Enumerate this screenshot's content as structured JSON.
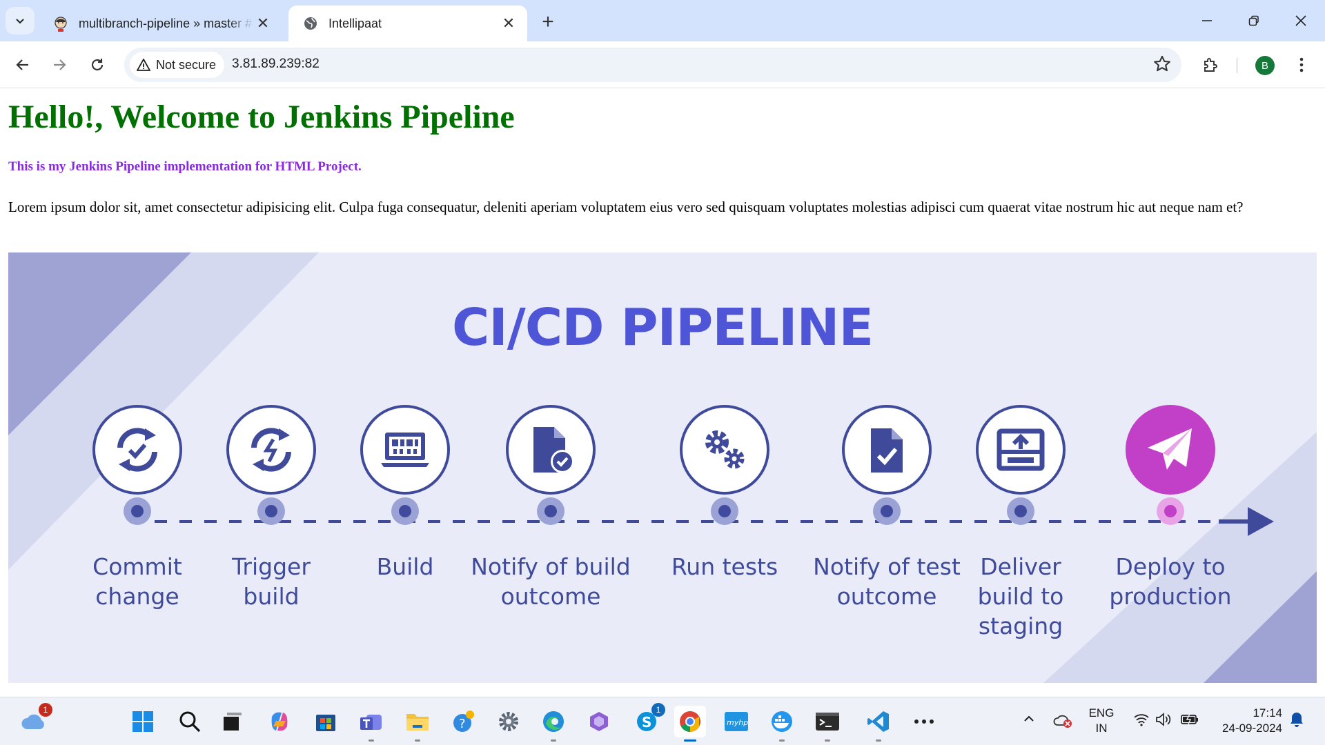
{
  "browser": {
    "tabs": [
      {
        "title": "multibranch-pipeline » master #",
        "favicon": "jenkins-icon",
        "active": false
      },
      {
        "title": "Intellipaat",
        "favicon": "globe-icon",
        "active": true
      }
    ],
    "security_label": "Not secure",
    "url": "3.81.89.239:82",
    "profile_initial": "B"
  },
  "page": {
    "heading": "Hello!, Welcome to Jenkins Pipeline",
    "subheading": "This is my Jenkins Pipeline implementation for HTML Project.",
    "paragraph": "Lorem ipsum dolor sit, amet consectetur adipisicing elit. Culpa fuga consequatur, deleniti aperiam voluptatem eius vero sed quisquam voluptates molestias adipisci cum quaerat vitae nostrum hic aut neque nam et?",
    "banner": {
      "title": "CI/CD PIPELINE",
      "steps": [
        {
          "label": "Commit\nchange",
          "icon": "commit-sync-icon"
        },
        {
          "label": "Trigger\nbuild",
          "icon": "trigger-sync-icon"
        },
        {
          "label": "Build",
          "icon": "build-computer-icon"
        },
        {
          "label": "Notify of build\noutcome",
          "icon": "file-check-icon"
        },
        {
          "label": "Run tests",
          "icon": "gears-icon"
        },
        {
          "label": "Notify of test\noutcome",
          "icon": "document-check-icon"
        },
        {
          "label": "Deliver\nbuild to\nstaging",
          "icon": "upload-tray-icon"
        },
        {
          "label": "Deploy to\nproduction",
          "icon": "paper-plane-icon"
        }
      ],
      "colors": {
        "primary": "#4f55d7",
        "icon_stroke": "#3f4b9a",
        "final_step": "#c23fc7",
        "background": "#e9ecf8"
      }
    }
  },
  "taskbar": {
    "weather_badge": "1",
    "skype_badge": "1",
    "language": "ENG",
    "region": "IN",
    "time": "17:14",
    "date": "24-09-2024",
    "apps": [
      "start-icon",
      "search-icon",
      "task-view-icon",
      "copilot-icon",
      "store-icon",
      "teams-icon",
      "file-explorer-icon",
      "get-help-icon",
      "settings-icon",
      "edge-icon",
      "copilot-app-icon",
      "skype-icon",
      "chrome-icon",
      "myhp-icon",
      "docker-icon",
      "terminal-icon",
      "vscode-icon",
      "more-icon"
    ]
  }
}
